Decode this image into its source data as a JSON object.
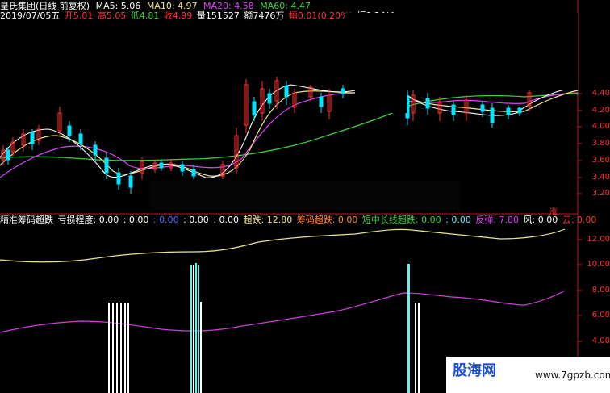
{
  "header": {
    "title": "皇氏集团(日线 前复权)",
    "ma5": "MA5: 5.06",
    "ma10": "MA10: 4.97",
    "ma20": "MA20: 4.58",
    "ma60": "MA60: 4.47",
    "date": "2019/07/05五",
    "open": "开5.01",
    "high": "高5.05",
    "low": "低4.81",
    "close": "收4.99",
    "volume": "量151527",
    "amount": "额7476万",
    "change": "幅0.01(0.20%)",
    "amplitude": "振0.24(4"
  },
  "price_axis": [
    "4.40",
    "4.20",
    "4.00",
    "3.80",
    "3.60",
    "3.40",
    "3.20"
  ],
  "indicator": {
    "name": "精准筹码超跌",
    "loss_label": "亏损程度: 0.00",
    "v1": ": 0.00",
    "v2": ": 0.00",
    "v3": ": 0.00",
    "v4": ": 0.00",
    "oversold": "超跌: 12.80",
    "chip_oversold": "筹码超跌: 0.00",
    "midlong_oversold": "短中长线超跌: 0.00",
    "v5": ": 0.00",
    "rebound": "反弹: 7.80",
    "wind": "风: 0.00",
    "cloud": "云: 0.00"
  },
  "indicator_axis": [
    "12.00",
    "10.00",
    "8.00",
    "6.00",
    "4.00"
  ],
  "limit_up_marker": "涨",
  "watermark": {
    "logo": "股海网",
    "url": "www.7gpzb.com"
  },
  "colors": {
    "up": "#ff3030",
    "down": "#00e5ff",
    "ma5": "#ffffff",
    "ma10": "#f0e68c",
    "ma20": "#e040fb",
    "ma60": "#3cd13c",
    "oversold_line": "#e8e890",
    "rebound_line": "#d040d8",
    "bar_white": "#ffffff",
    "bar_cyan": "#60f0f0"
  }
}
